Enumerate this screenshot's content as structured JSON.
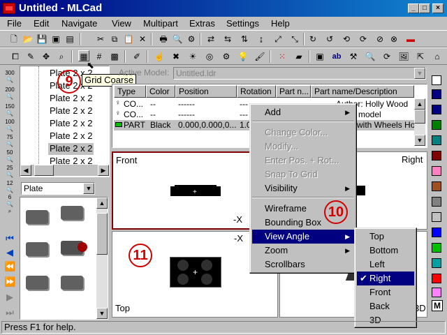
{
  "window": {
    "title": "Untitled - MLCad",
    "min": "_",
    "max": "□",
    "close": "×"
  },
  "menu": [
    "File",
    "Edit",
    "Navigate",
    "View",
    "Multipart",
    "Extras",
    "Settings",
    "Help"
  ],
  "tooltip": "Grid Coarse",
  "left_zoom_labels": [
    "300",
    "200",
    "150",
    "100",
    "75",
    "50",
    "25",
    "12",
    "6"
  ],
  "tree": {
    "items": [
      "Plate  2 x 2",
      "Plate  2 x 2",
      "Plate  2 x 2",
      "Plate  2 x 2",
      "Plate  2 x 2",
      "Plate  2 x 2",
      "Plate  2 x 2",
      "Plate  2 x 2"
    ]
  },
  "category": {
    "selected": "Plate"
  },
  "model": {
    "label": "Active Model:",
    "value": "Untitled.ldr"
  },
  "parts_list": {
    "headers": [
      "Type",
      "Color",
      "Position",
      "Rotation",
      "Part n...",
      "Part name/Description"
    ],
    "rows": [
      {
        "type": "CO...",
        "color": "--",
        "position": "------",
        "rotation": "---",
        "part": "",
        "desc": "Author: Holly Wood"
      },
      {
        "type": "CO...",
        "color": "--",
        "position": "------",
        "rotation": "---",
        "part": "",
        "desc": "model"
      },
      {
        "type": "PART",
        "color": "Black",
        "position": "0.000,0.000,0...",
        "rotation": "1.0",
        "part": "",
        "desc": "with Wheels Hold"
      }
    ]
  },
  "viewports": {
    "front": "Front",
    "right": "Right",
    "top": "Top",
    "axis": "-X",
    "axis2": "-X",
    "threed": "3D"
  },
  "context_menu": {
    "items": [
      {
        "label": "Add",
        "submenu": true,
        "disabled": false
      },
      {
        "label": "Change Color...",
        "submenu": false,
        "disabled": true
      },
      {
        "label": "Modify...",
        "submenu": false,
        "disabled": true
      },
      {
        "label": "Enter Pos. + Rot...",
        "submenu": false,
        "disabled": true
      },
      {
        "label": "Snap To Grid",
        "submenu": false,
        "disabled": true
      },
      {
        "label": "Visibility",
        "submenu": true,
        "disabled": false
      },
      {
        "label": "Wireframe",
        "submenu": false,
        "disabled": false
      },
      {
        "label": "Bounding Box",
        "submenu": false,
        "disabled": false
      },
      {
        "label": "View Angle",
        "submenu": true,
        "disabled": false,
        "selected": true
      },
      {
        "label": "Zoom",
        "submenu": true,
        "disabled": false
      },
      {
        "label": "Scrollbars",
        "submenu": false,
        "disabled": false
      }
    ]
  },
  "view_angle_menu": {
    "items": [
      {
        "label": "Top",
        "checked": false
      },
      {
        "label": "Bottom",
        "checked": false
      },
      {
        "label": "Left",
        "checked": false
      },
      {
        "label": "Right",
        "checked": true
      },
      {
        "label": "Front",
        "checked": false
      },
      {
        "label": "Back",
        "checked": false
      },
      {
        "label": "3D",
        "checked": false
      }
    ]
  },
  "callouts": [
    "9",
    "10",
    "11"
  ],
  "colors": [
    "#ffffff",
    "#000080",
    "#000080",
    "#008000",
    "#008080",
    "#800000",
    "#ff80c0",
    "#a05020",
    "#808080",
    "#c0c0c0",
    "#0000ff",
    "#00c000",
    "#00a0a0",
    "#ff0000",
    "#ff80ff",
    "#ffff00",
    "#000000"
  ],
  "status": "Press F1 for help."
}
